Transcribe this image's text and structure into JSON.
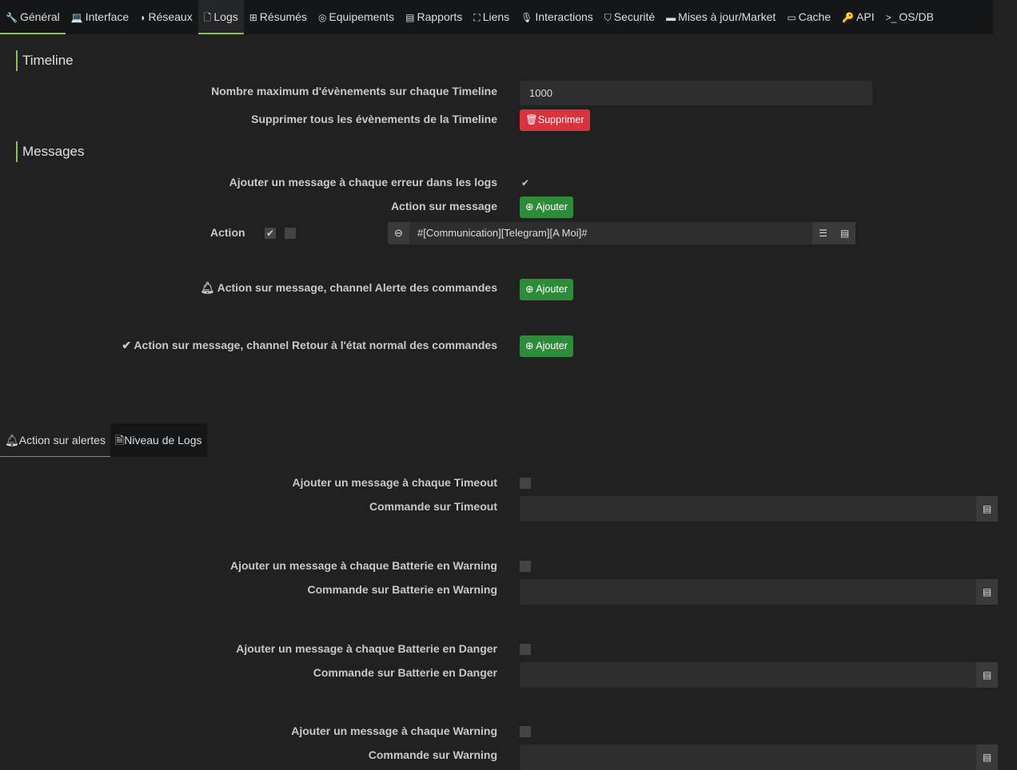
{
  "nav": {
    "tabs": [
      {
        "icon": "wrench-icon",
        "glyph": "🔧",
        "label": "Général"
      },
      {
        "icon": "laptop-icon",
        "glyph": "💻",
        "label": "Interface"
      },
      {
        "icon": "rss-icon",
        "glyph": "◗",
        "label": "Réseaux"
      },
      {
        "icon": "file-icon",
        "glyph": "🗋",
        "label": "Logs"
      },
      {
        "icon": "table-icon",
        "glyph": "⊞",
        "label": "Résumés"
      },
      {
        "icon": "equipment-icon",
        "glyph": "◎",
        "label": "Equipements"
      },
      {
        "icon": "report-icon",
        "glyph": "▤",
        "label": "Rapports"
      },
      {
        "icon": "sitemap-icon",
        "glyph": "⛶",
        "label": "Liens"
      },
      {
        "icon": "microphone-icon",
        "glyph": "🎙",
        "label": "Interactions"
      },
      {
        "icon": "shield-icon",
        "glyph": "⛉",
        "label": "Securité"
      },
      {
        "icon": "server-icon",
        "glyph": "▬",
        "label": "Mises à jour/Market"
      },
      {
        "icon": "hdd-icon",
        "glyph": "▭",
        "label": "Cache"
      },
      {
        "icon": "key-icon",
        "glyph": "🔑",
        "label": "API"
      },
      {
        "icon": "terminal-icon",
        "glyph": ">_",
        "label": "OS/DB"
      }
    ]
  },
  "timeline": {
    "title": "Timeline",
    "max_label": "Nombre maximum d'évènements sur chaque Timeline",
    "max_value": "1000",
    "delete_label": "Supprimer tous les évènements de la Timeline",
    "delete_button": "Supprimer"
  },
  "messages": {
    "title": "Messages",
    "add_error_label": "Ajouter un message à chaque erreur dans les logs",
    "add_error_checked": true,
    "action_label": "Action sur message",
    "add_button": "Ajouter",
    "action_row_label": "Action",
    "action_value": "#[Communication][Telegram][A Moi]#",
    "alert_label": "Action sur message, channel Alerte des commandes",
    "return_label": "Action sur message, channel Retour à l'état normal des commandes"
  },
  "subtabs": [
    {
      "label": "Action sur alertes"
    },
    {
      "label": "Niveau de Logs"
    }
  ],
  "alerts": [
    {
      "check_label": "Ajouter un message à chaque Timeout",
      "cmd_label": "Commande sur Timeout"
    },
    {
      "check_label": "Ajouter un message à chaque Batterie en Warning",
      "cmd_label": "Commande sur Batterie en Warning"
    },
    {
      "check_label": "Ajouter un message à chaque Batterie en Danger",
      "cmd_label": "Commande sur Batterie en Danger"
    },
    {
      "check_label": "Ajouter un message à chaque Warning",
      "cmd_label": "Commande sur Warning"
    }
  ]
}
